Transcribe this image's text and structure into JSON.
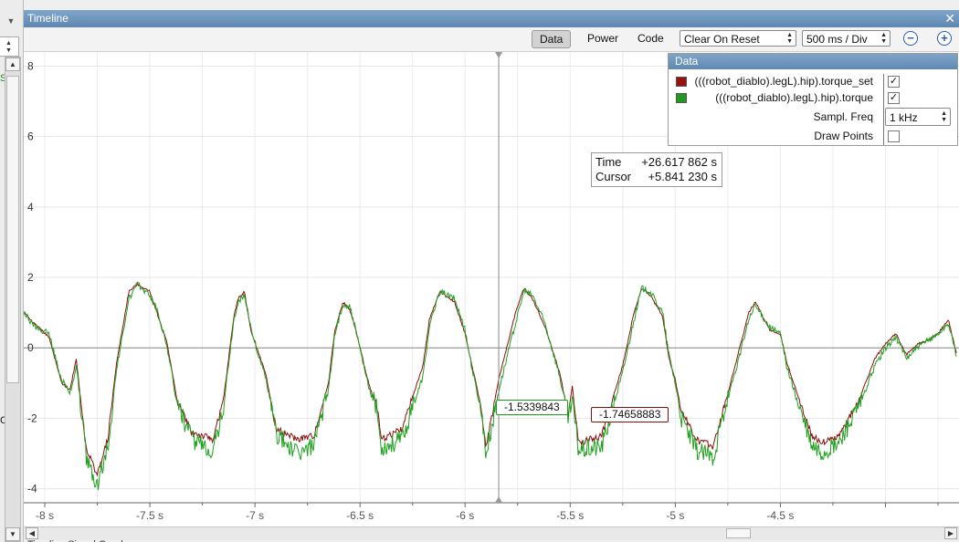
{
  "window": {
    "title": "Timeline",
    "close_glyph": "✕"
  },
  "left_panel": {
    "partial_char_top": "S",
    "partial_char_bottom": "C"
  },
  "toolbar": {
    "tabs": [
      "Data",
      "Power",
      "Code"
    ],
    "active_tab": "Data",
    "clear_mode": "Clear On Reset",
    "time_scale": "500 ms / Div",
    "zoom_out_glyph": "−",
    "zoom_in_glyph": "+"
  },
  "data_panel": {
    "title": "Data",
    "series": [
      {
        "name": "(((robot_diablo).legL).hip).torque_set",
        "color": "#9c1010",
        "checked": true
      },
      {
        "name": "(((robot_diablo).legL).hip).torque",
        "color": "#1f9a1f",
        "checked": true
      }
    ],
    "sampl_freq_label": "Sampl. Freq",
    "sampl_freq_value": "1 kHz",
    "draw_points_label": "Draw Points",
    "draw_points_checked": false,
    "check_glyph": "✓"
  },
  "cursor_info": {
    "time_label": "Time",
    "time_value": "+26.617 862 s",
    "cursor_label": "Cursor",
    "cursor_value": "+5.841 230 s"
  },
  "value_labels": {
    "torque": "-1.5339843",
    "torque_set": "-1.74658883"
  },
  "bottom_tabs_text": "Timeline   Signal Graph",
  "chart_data": {
    "type": "line",
    "x_unit": "s",
    "xlim": [
      -8.1,
      -3.65
    ],
    "ylim": [
      -4.4,
      8.4
    ],
    "x_ticks": [
      "-8 s",
      "-7.5 s",
      "-7 s",
      "-6.5 s",
      "-6 s",
      "-5.5 s",
      "-5 s",
      "-4.5 s"
    ],
    "x_tick_values": [
      -8,
      -7.5,
      -7,
      -6.5,
      -6,
      -5.5,
      -5,
      -4.5
    ],
    "y_ticks": [
      "8",
      "6",
      "4",
      "2",
      "0",
      "-2",
      "-4"
    ],
    "y_tick_values": [
      8,
      6,
      4,
      2,
      0,
      -2,
      -4
    ],
    "cursor_x": -5.84,
    "grid": true,
    "series": [
      {
        "name": "(((robot_diablo).legL).hip).torque_set",
        "color": "#8b0d0d",
        "x": [
          -8.13,
          -8.05,
          -7.98,
          -7.92,
          -7.88,
          -7.85,
          -7.82,
          -7.8,
          -7.75,
          -7.7,
          -7.66,
          -7.6,
          -7.56,
          -7.5,
          -7.46,
          -7.44,
          -7.42,
          -7.37,
          -7.3,
          -7.2,
          -7.15,
          -7.1,
          -7.08,
          -7.05,
          -7.02,
          -6.98,
          -6.95,
          -6.9,
          -6.8,
          -6.72,
          -6.65,
          -6.62,
          -6.58,
          -6.55,
          -6.52,
          -6.48,
          -6.45,
          -6.42,
          -6.4,
          -6.3,
          -6.2,
          -6.17,
          -6.12,
          -6.05,
          -6.0,
          -5.96,
          -5.93,
          -5.9,
          -5.84,
          -5.76,
          -5.72,
          -5.68,
          -5.62,
          -5.55,
          -5.51,
          -5.49,
          -5.46,
          -5.35,
          -5.25,
          -5.2,
          -5.16,
          -5.12,
          -5.06,
          -5.03,
          -5.0,
          -4.97,
          -4.9,
          -4.82,
          -4.75,
          -4.65,
          -4.62,
          -4.55,
          -4.5,
          -4.47,
          -4.42,
          -4.35,
          -4.3,
          -4.22,
          -4.12,
          -4.05,
          -4.0,
          -3.95,
          -3.9,
          -3.85,
          -3.8,
          -3.75,
          -3.7,
          -3.66
        ],
        "y": [
          1.2,
          0.7,
          0.3,
          -1.0,
          -1.2,
          -0.3,
          -2.0,
          -2.9,
          -3.6,
          -2.6,
          -0.5,
          1.6,
          1.8,
          1.6,
          0.9,
          0.5,
          0.2,
          -1.5,
          -2.4,
          -2.6,
          -1.5,
          0.9,
          1.4,
          1.6,
          0.5,
          -0.2,
          -0.7,
          -2.3,
          -2.6,
          -2.5,
          -1.0,
          0.5,
          1.3,
          1.1,
          0.5,
          -0.5,
          -1.2,
          -1.6,
          -2.6,
          -2.3,
          -0.5,
          0.8,
          1.6,
          1.3,
          0.4,
          -0.7,
          -1.5,
          -2.8,
          -0.9,
          1.0,
          1.7,
          1.4,
          0.6,
          -0.7,
          -1.9,
          -1.1,
          -2.7,
          -2.5,
          -0.5,
          0.9,
          1.7,
          1.5,
          0.9,
          -0.3,
          -0.9,
          -1.8,
          -2.6,
          -2.8,
          -1.3,
          1.0,
          1.3,
          0.5,
          0.4,
          -0.4,
          -1.3,
          -2.5,
          -2.7,
          -2.5,
          -1.4,
          -0.3,
          0.1,
          0.4,
          -0.2,
          0.1,
          0.2,
          0.4,
          0.8,
          -0.2
        ]
      },
      {
        "name": "(((robot_diablo).legL).hip).torque",
        "color": "#1fa01f",
        "x": [
          -8.13,
          -8.05,
          -7.98,
          -7.92,
          -7.88,
          -7.85,
          -7.82,
          -7.8,
          -7.75,
          -7.7,
          -7.66,
          -7.6,
          -7.56,
          -7.5,
          -7.46,
          -7.44,
          -7.42,
          -7.37,
          -7.3,
          -7.2,
          -7.15,
          -7.1,
          -7.08,
          -7.05,
          -7.02,
          -6.98,
          -6.95,
          -6.9,
          -6.8,
          -6.72,
          -6.65,
          -6.62,
          -6.58,
          -6.55,
          -6.52,
          -6.48,
          -6.45,
          -6.42,
          -6.4,
          -6.3,
          -6.2,
          -6.17,
          -6.12,
          -6.05,
          -6.0,
          -5.96,
          -5.93,
          -5.9,
          -5.84,
          -5.76,
          -5.72,
          -5.68,
          -5.62,
          -5.55,
          -5.51,
          -5.49,
          -5.46,
          -5.35,
          -5.25,
          -5.2,
          -5.16,
          -5.12,
          -5.06,
          -5.03,
          -5.0,
          -4.97,
          -4.9,
          -4.82,
          -4.75,
          -4.65,
          -4.62,
          -4.55,
          -4.5,
          -4.47,
          -4.42,
          -4.35,
          -4.3,
          -4.22,
          -4.12,
          -4.05,
          -4.0,
          -3.95,
          -3.9,
          -3.85,
          -3.8,
          -3.75,
          -3.7,
          -3.66
        ],
        "y": [
          1.3,
          0.6,
          0.4,
          -0.9,
          -1.3,
          -0.5,
          -2.1,
          -3.2,
          -3.9,
          -2.8,
          -0.7,
          1.4,
          1.8,
          1.5,
          1.0,
          0.5,
          0.1,
          -1.6,
          -2.6,
          -2.9,
          -1.7,
          0.8,
          1.3,
          1.5,
          0.6,
          -0.3,
          -0.8,
          -2.4,
          -3.0,
          -2.8,
          -1.2,
          0.4,
          1.2,
          1.2,
          0.5,
          -0.6,
          -1.3,
          -1.7,
          -2.8,
          -2.6,
          -0.8,
          0.6,
          1.6,
          1.4,
          0.5,
          -0.8,
          -1.6,
          -3.0,
          -1.2,
          0.7,
          1.6,
          1.5,
          0.7,
          -0.8,
          -2.0,
          -1.5,
          -2.9,
          -2.8,
          -0.7,
          0.7,
          1.7,
          1.6,
          1.0,
          -0.2,
          -1.0,
          -2.0,
          -2.9,
          -3.1,
          -1.5,
          0.8,
          1.2,
          0.6,
          0.4,
          -0.5,
          -1.5,
          -2.8,
          -3.0,
          -2.7,
          -1.6,
          -0.5,
          0.0,
          0.3,
          -0.3,
          0.0,
          0.2,
          0.4,
          0.7,
          -0.3
        ]
      }
    ]
  }
}
